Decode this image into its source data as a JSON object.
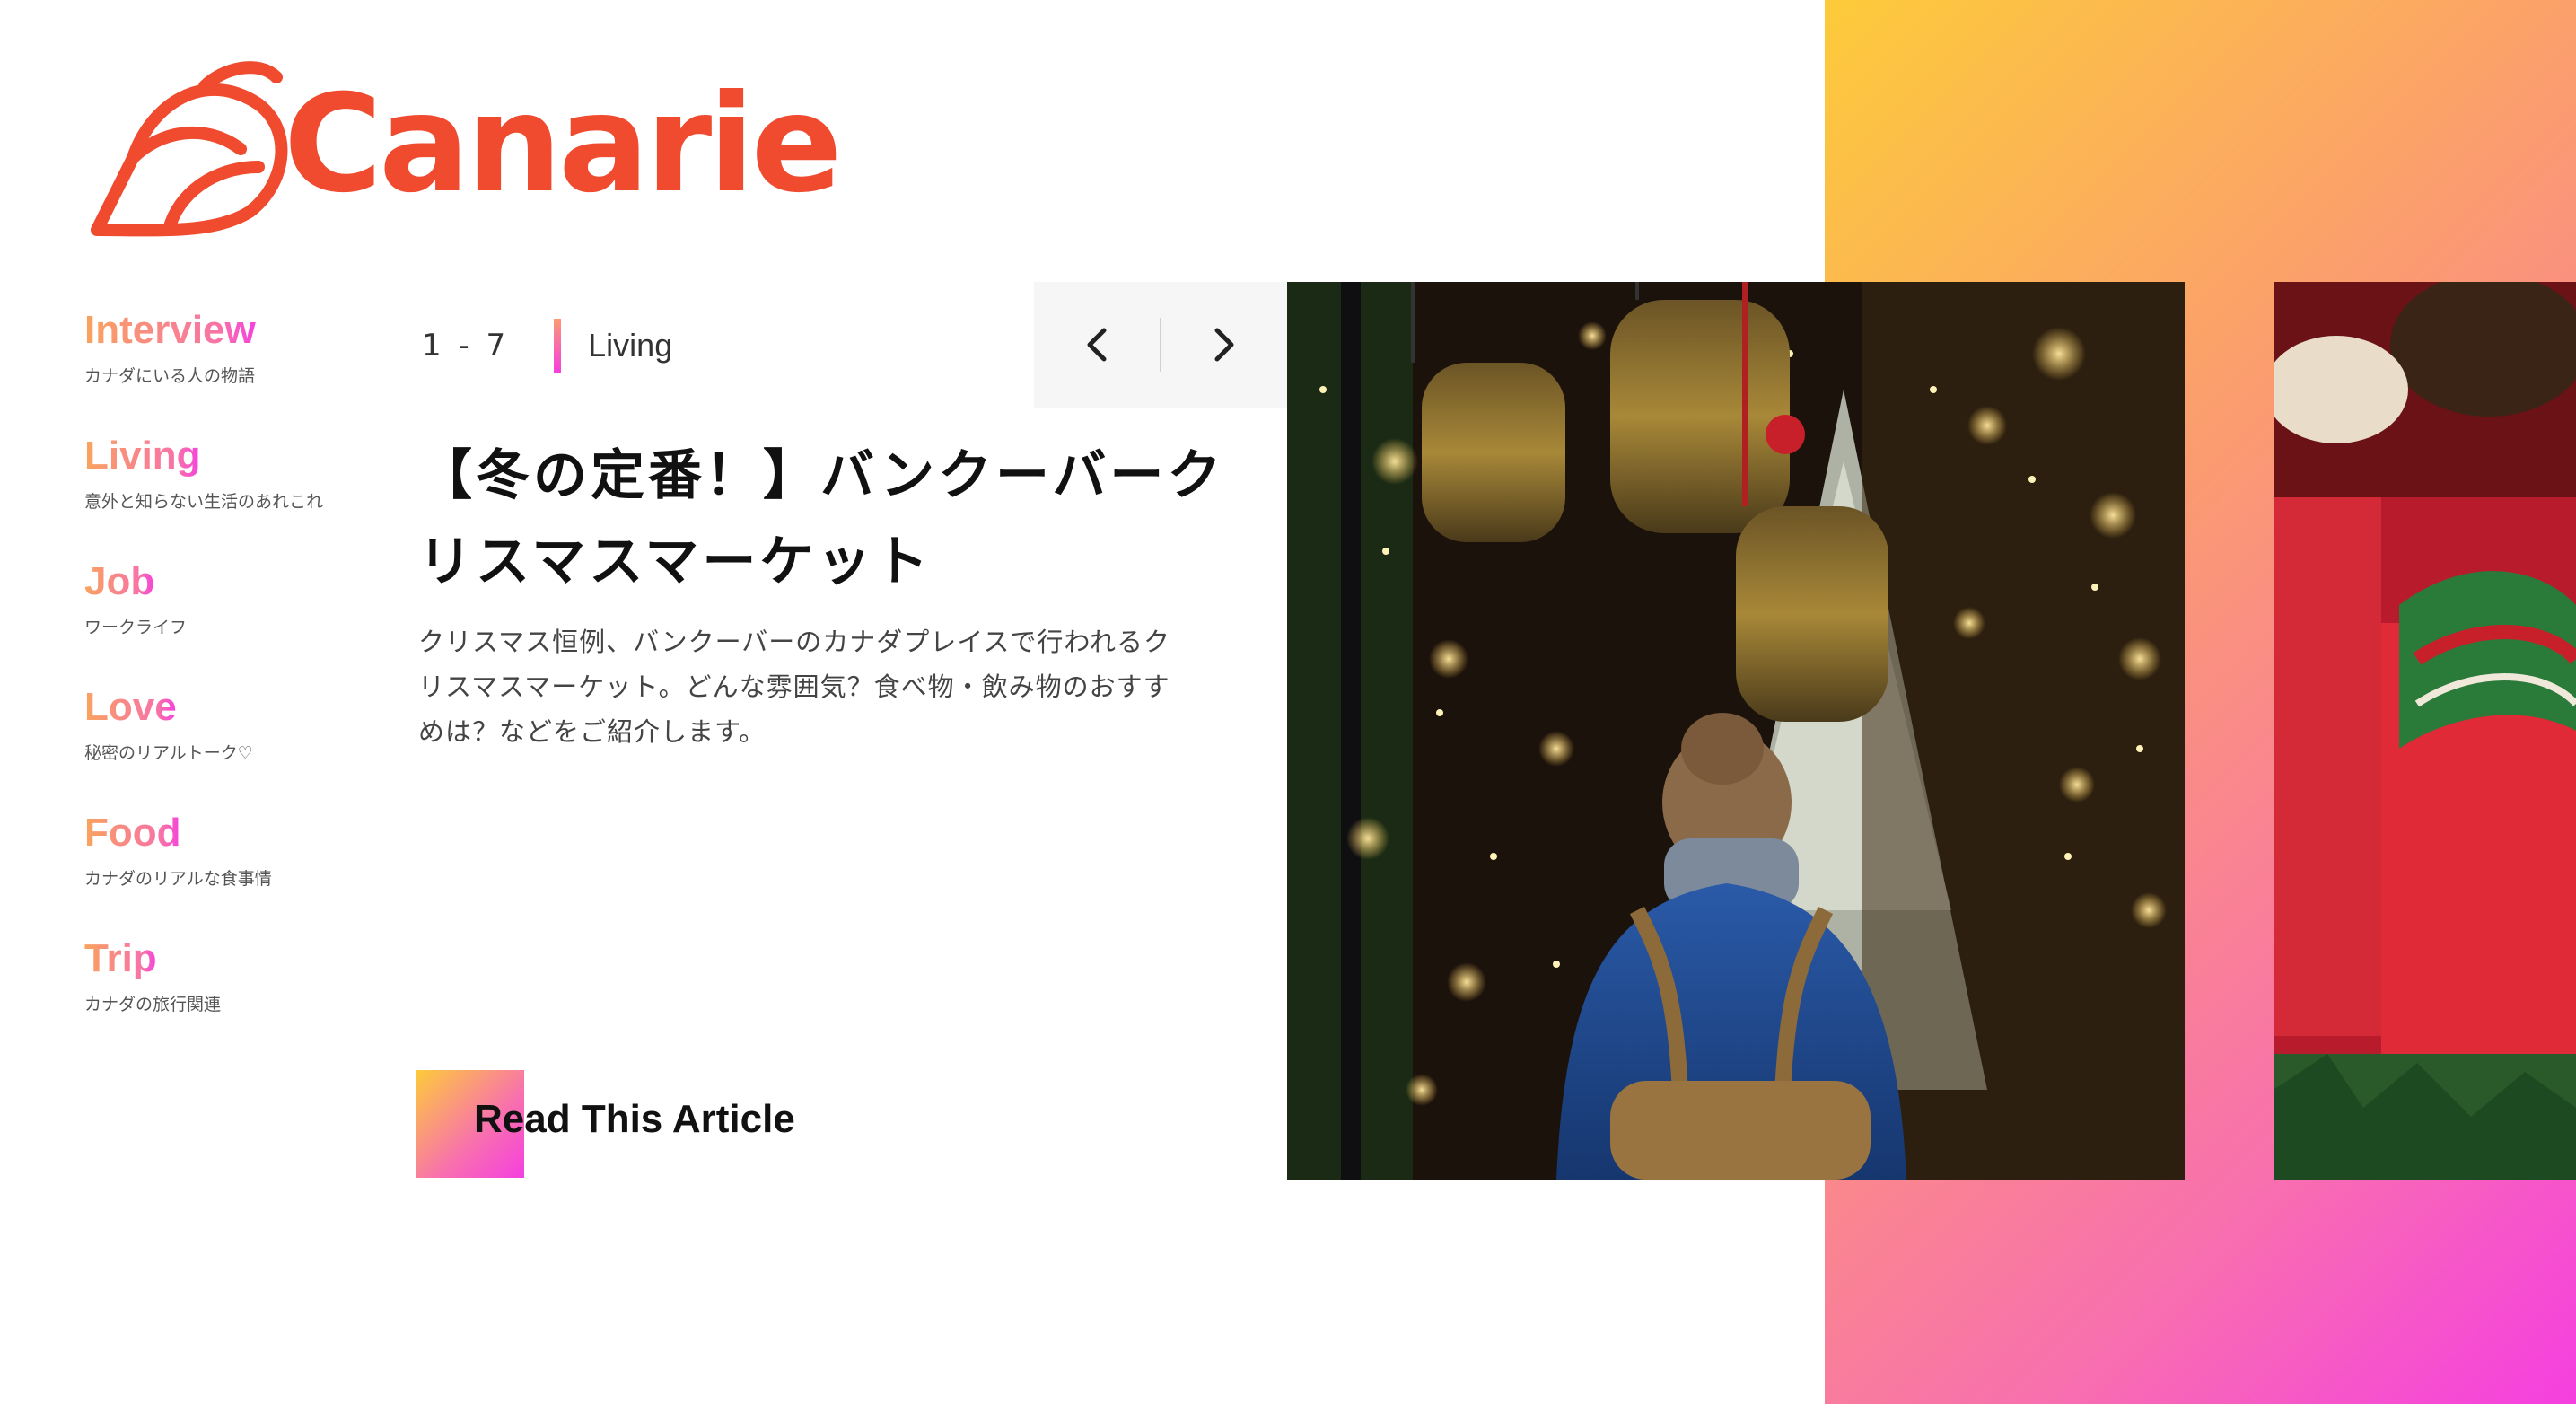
{
  "brand": {
    "name": "Canarie",
    "color": "#f04a2f"
  },
  "sidebar": {
    "items": [
      {
        "label": "Interview",
        "sub": "カナダにいる人の物語"
      },
      {
        "label": "Living",
        "sub": "意外と知らない生活のあれこれ"
      },
      {
        "label": "Job",
        "sub": "ワークライフ"
      },
      {
        "label": "Love",
        "sub": "秘密のリアルトーク♡"
      },
      {
        "label": "Food",
        "sub": "カナダのリアルな食事情"
      },
      {
        "label": "Trip",
        "sub": "カナダの旅行関連"
      }
    ]
  },
  "article": {
    "count": "1 - 7",
    "category": "Living",
    "title_line1": "【冬の定番！】バンクーバーク",
    "title_line2": "リスマスマーケット",
    "desc_line1": "クリスマス恒例、バンクーバーのカナダプレイスで行われるク",
    "desc_line2": "リスマスマーケット。どんな雰囲気？食べ物・飲み物のおすす",
    "desc_line3": "めは？などをご紹介します。",
    "cta": "Read This Article"
  },
  "nav": {
    "prev_icon": "chevron-left-icon",
    "next_icon": "chevron-right-icon"
  },
  "colors": {
    "gradient_start": "#fdcb3a",
    "gradient_mid": "#f870ae",
    "gradient_end": "#f53fe0",
    "accent": "#f04a2f"
  }
}
